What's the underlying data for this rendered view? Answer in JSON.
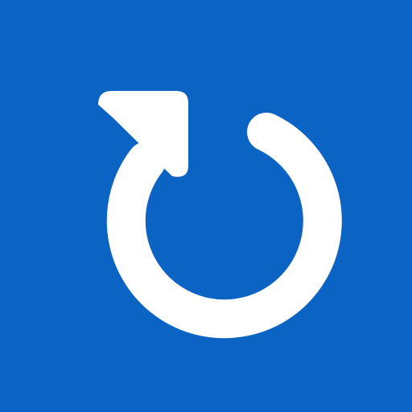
{
  "icon": {
    "name": "refresh-icon",
    "background_color": "#0b63c3",
    "foreground_color": "#ffffff"
  }
}
